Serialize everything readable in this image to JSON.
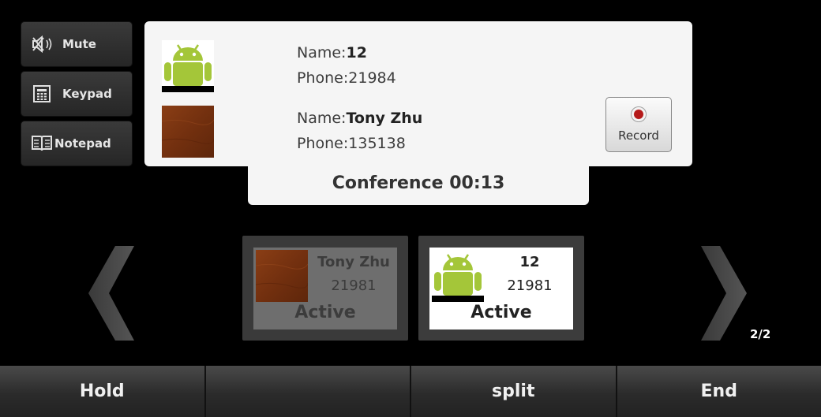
{
  "side_buttons": {
    "mute": "Mute",
    "keypad": "Keypad",
    "notepad": "Notepad"
  },
  "conference": {
    "parties": [
      {
        "name_label": "Name:",
        "name": "12",
        "phone_label": "Phone:",
        "phone": "21984",
        "avatar": "android-icon"
      },
      {
        "name_label": "Name:",
        "name": "Tony Zhu",
        "phone_label": "Phone:",
        "phone": "135138",
        "avatar": "leather-texture"
      }
    ],
    "record_label": "Record",
    "status": "Conference 00:13"
  },
  "calls": [
    {
      "name": "Tony Zhu",
      "number": "21981",
      "state": "Active",
      "selected": false
    },
    {
      "name": "12",
      "number": "21981",
      "state": "Active",
      "selected": true
    }
  ],
  "page_indicator": "2/2",
  "softkeys": [
    "Hold",
    "",
    "split",
    "End"
  ],
  "colors": {
    "card_bg": "#f5f5f5",
    "record_red": "#b51a1a",
    "android_green": "#a4c639",
    "leather": "#7a3512"
  }
}
